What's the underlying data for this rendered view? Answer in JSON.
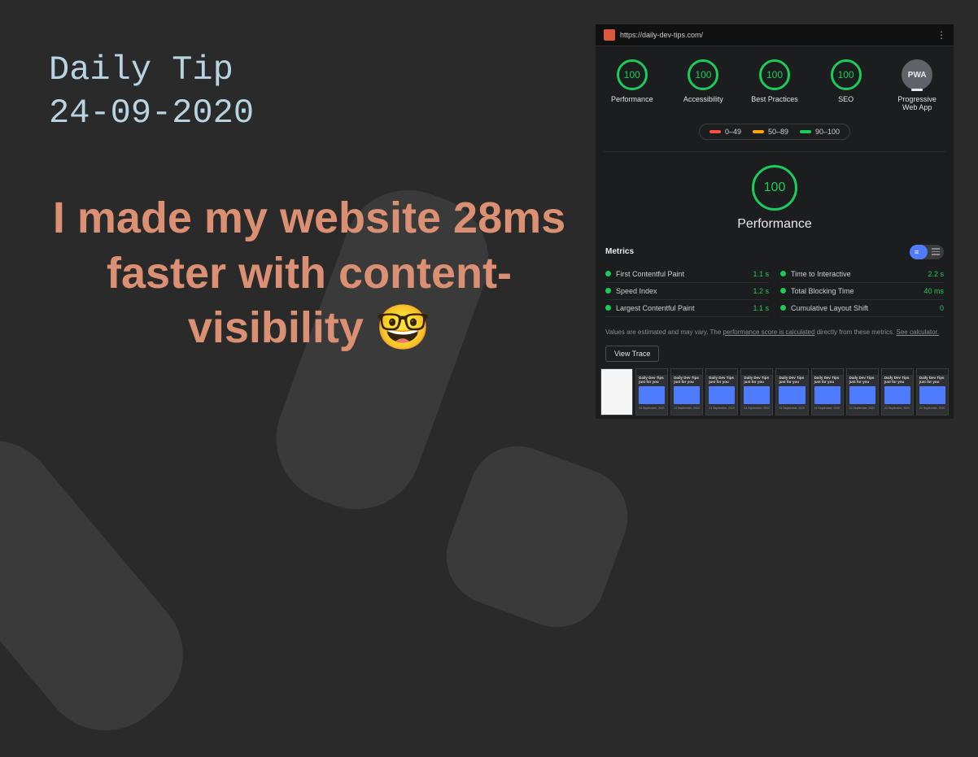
{
  "kicker_line1": "Daily Tip",
  "kicker_line2": "24-09-2020",
  "headline": "I made my website 28ms faster with content-visibility 🤓",
  "lighthouse": {
    "url": "https://daily-dev-tips.com/",
    "gauges": [
      {
        "score": "100",
        "label": "Performance"
      },
      {
        "score": "100",
        "label": "Accessibility"
      },
      {
        "score": "100",
        "label": "Best Practices"
      },
      {
        "score": "100",
        "label": "SEO"
      },
      {
        "pwa": "PWA",
        "label": "Progressive Web App"
      }
    ],
    "legend": {
      "low": "0–49",
      "mid": "50–89",
      "high": "90–100"
    },
    "big_score": "100",
    "big_label": "Performance",
    "metrics_heading": "Metrics",
    "metrics": [
      {
        "name": "First Contentful Paint",
        "value": "1.1 s"
      },
      {
        "name": "Time to Interactive",
        "value": "2.2 s"
      },
      {
        "name": "Speed Index",
        "value": "1.2 s"
      },
      {
        "name": "Total Blocking Time",
        "value": "40 ms"
      },
      {
        "name": "Largest Contentful Paint",
        "value": "1.1 s"
      },
      {
        "name": "Cumulative Layout Shift",
        "value": "0"
      }
    ],
    "footnote_prefix": "Values are estimated and may vary. The ",
    "footnote_link1": "performance score is calculated",
    "footnote_mid": " directly from these metrics. ",
    "footnote_link2": "See calculator.",
    "view_trace": "View Trace",
    "thumb_title": "Daily Dev Tips just for you",
    "thumb_meta": "24 September, 2020"
  }
}
